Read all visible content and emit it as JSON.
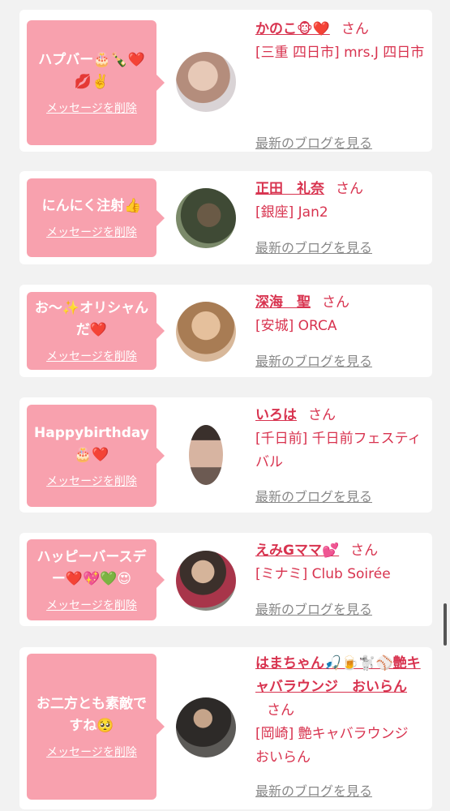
{
  "delete_label": "メッセージを削除",
  "blog_label": "最新のブログを見る",
  "san": "さん",
  "items": [
    {
      "message": "ハプバー🎂🍾❤️💋✌️",
      "name": "かのこ🐵❤️",
      "shop": "[三重 四日市] mrs.J 四日市"
    },
    {
      "message": "にんにく注射👍",
      "name": "正田　礼奈",
      "shop": "[銀座] Jan2"
    },
    {
      "message": "お〜✨オリシャんだ❤️",
      "name": "深海　聖",
      "shop": "[安城] ORCA"
    },
    {
      "message": "Happybirthday🎂❤️",
      "name": "いろは",
      "shop": "[千日前] 千日前フェスティバル"
    },
    {
      "message": "ハッピーバースデー❤️💖💚😍",
      "name": "えみGママ💕",
      "shop": "[ミナミ] Club Soirée"
    },
    {
      "message": "お二方とも素敵ですね🥺",
      "name": "はまちゃん🎣🍺🐩⚾艶キャバラウンジ　おいらん",
      "shop": "[岡崎] 艶キャバラウンジ おいらん"
    }
  ],
  "colors": {
    "bubble": "#f8a1ae",
    "accent": "#d8334f",
    "link": "#888888",
    "background": "#f2f2f2"
  }
}
